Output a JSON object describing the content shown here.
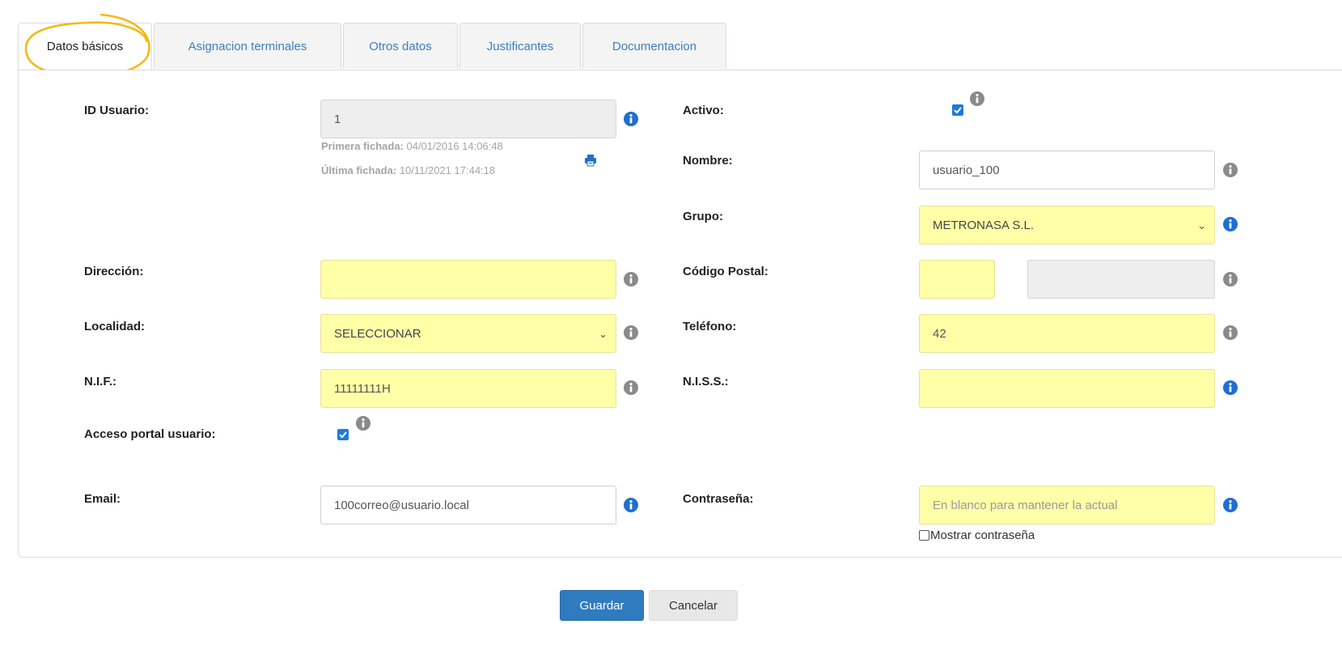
{
  "tabs": [
    {
      "label": "Datos básicos",
      "active": true
    },
    {
      "label": "Asignacion terminales",
      "active": false
    },
    {
      "label": "Otros datos",
      "active": false
    },
    {
      "label": "Justificantes",
      "active": false
    },
    {
      "label": "Documentacion",
      "active": false
    }
  ],
  "form": {
    "id_usuario": {
      "label": "ID Usuario:",
      "value": "1"
    },
    "primera_fichada": {
      "label": "Primera fichada:",
      "value": "04/01/2016 14:06:48"
    },
    "ultima_fichada": {
      "label": "Última fichada:",
      "value": "10/11/2021 17:44:18"
    },
    "activo": {
      "label": "Activo:",
      "checked": true
    },
    "nombre": {
      "label": "Nombre:",
      "value": "usuario_100"
    },
    "grupo": {
      "label": "Grupo:",
      "value": "METRONASA S.L."
    },
    "direccion": {
      "label": "Dirección:",
      "value": ""
    },
    "codigo_postal": {
      "label": "Código Postal:",
      "value": "",
      "value2": ""
    },
    "localidad": {
      "label": "Localidad:",
      "value": "SELECCIONAR"
    },
    "telefono": {
      "label": "Teléfono:",
      "value": "42"
    },
    "nif": {
      "label": "N.I.F.:",
      "value": "11111111H"
    },
    "niss": {
      "label": "N.I.S.S.:",
      "value": ""
    },
    "acceso_portal": {
      "label": "Acceso portal usuario:",
      "checked": true
    },
    "email": {
      "label": "Email:",
      "value": "100correo@usuario.local"
    },
    "contrasena": {
      "label": "Contraseña:",
      "placeholder": "En blanco para mantener la actual",
      "value": ""
    },
    "mostrar_contrasena": {
      "label": "Mostrar contraseña",
      "checked": false
    }
  },
  "actions": {
    "save": "Guardar",
    "cancel": "Cancelar"
  },
  "colors": {
    "required_field_bg": "#ffffa8",
    "readonly_field_bg": "#eeeeee",
    "tab_link": "#3d7fc1",
    "primary_button": "#2f7bc0",
    "info_icon_blue": "#1f6fd1",
    "info_icon_gray": "#8a8a8a",
    "tab_highlight_circle": "#f2b90f"
  }
}
